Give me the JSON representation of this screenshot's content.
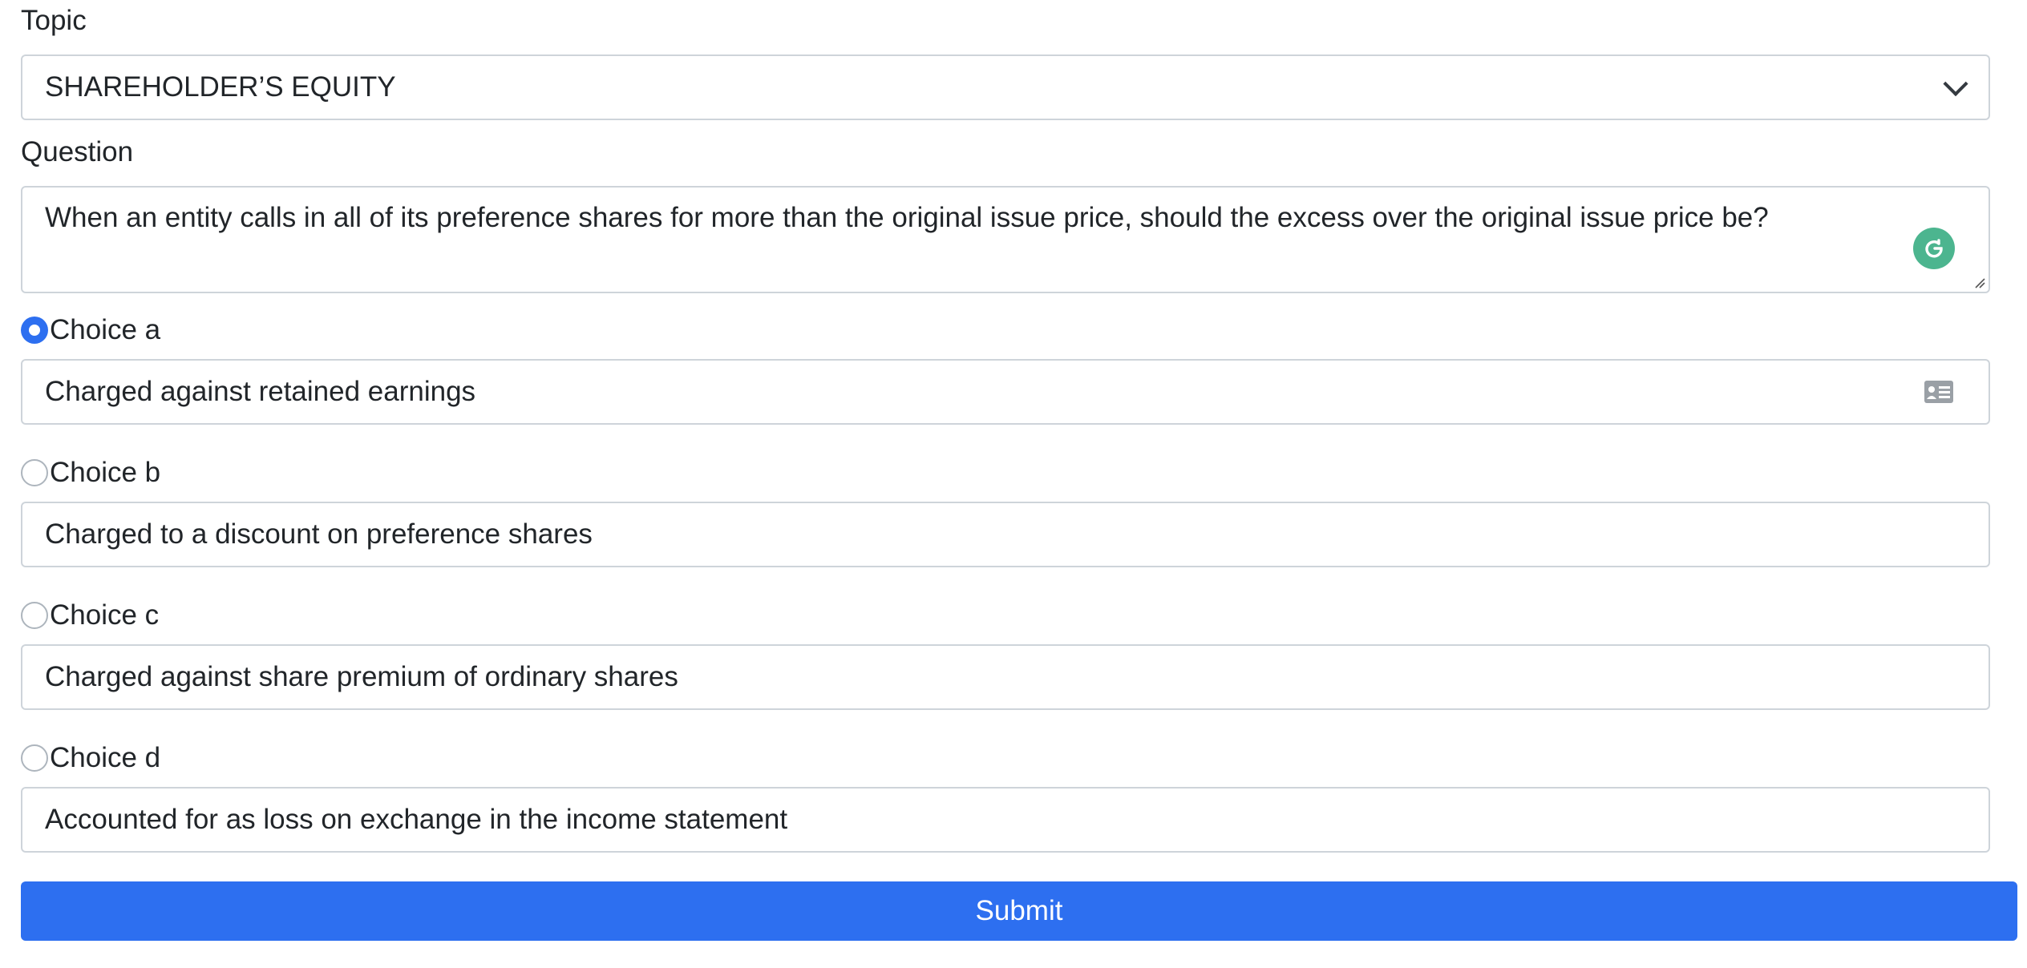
{
  "topic": {
    "label": "Topic",
    "selected": "SHAREHOLDER’S EQUITY"
  },
  "question": {
    "label": "Question",
    "value": "When an entity calls in all of its preference shares for more than the original issue price, should the excess over the original issue price be?"
  },
  "choices": [
    {
      "label": "Choice a",
      "value": "Charged against retained earnings",
      "checked": true
    },
    {
      "label": "Choice b",
      "value": "Charged to a discount on preference shares",
      "checked": false
    },
    {
      "label": "Choice c",
      "value": "Charged against share premium of ordinary shares",
      "checked": false
    },
    {
      "label": "Choice d",
      "value": "Accounted for as loss on exchange in the income statement",
      "checked": false
    }
  ],
  "submit_label": "Submit",
  "colors": {
    "accent": "#2d6ff0",
    "grammarly": "#4cb58f",
    "border": "#ced4da"
  }
}
